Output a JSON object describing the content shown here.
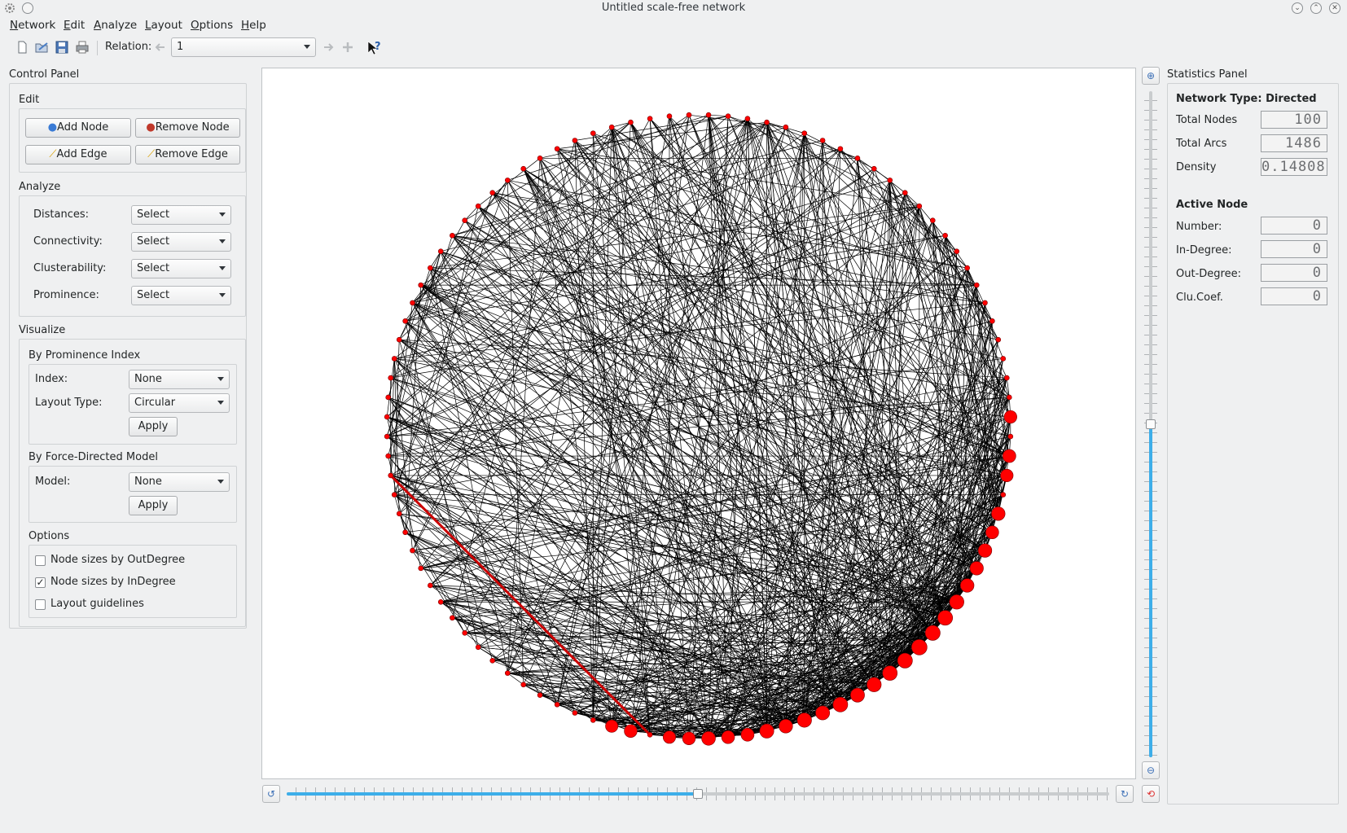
{
  "window": {
    "title": "Untitled scale-free network"
  },
  "menubar": {
    "items": [
      "Network",
      "Edit",
      "Analyze",
      "Layout",
      "Options",
      "Help"
    ],
    "mnemonics": [
      "N",
      "E",
      "A",
      "L",
      "O",
      "H"
    ]
  },
  "toolbar": {
    "relation_label": "Relation:",
    "relation_value": "1",
    "icons": [
      "new-file-icon",
      "open-file-icon",
      "save-icon",
      "print-icon",
      "previous-relation-icon",
      "next-relation-icon",
      "add-relation-icon",
      "whats-this-icon"
    ]
  },
  "control_panel": {
    "title": "Control Panel",
    "edit": {
      "title": "Edit",
      "add_node": "Add Node",
      "remove_node": "Remove Node",
      "add_edge": "Add Edge",
      "remove_edge": "Remove Edge"
    },
    "analyze": {
      "title": "Analyze",
      "rows": [
        {
          "label": "Distances:",
          "value": "Select"
        },
        {
          "label": "Connectivity:",
          "value": "Select"
        },
        {
          "label": "Clusterability:",
          "value": "Select"
        },
        {
          "label": "Prominence:",
          "value": "Select"
        }
      ]
    },
    "visualize": {
      "title": "Visualize",
      "prominence": {
        "title": "By Prominence Index",
        "index_label": "Index:",
        "index_value": "None",
        "layout_label": "Layout Type:",
        "layout_value": "Circular",
        "apply": "Apply"
      },
      "force": {
        "title": "By Force-Directed Model",
        "model_label": "Model:",
        "model_value": "None",
        "apply": "Apply"
      }
    },
    "options": {
      "title": "Options",
      "items": [
        {
          "label": "Node sizes by OutDegree",
          "checked": false
        },
        {
          "label": "Node sizes by InDegree",
          "checked": true
        },
        {
          "label": "Layout guidelines",
          "checked": false
        }
      ]
    }
  },
  "statistics_panel": {
    "title": "Statistics Panel",
    "network_type": "Network Type: Directed",
    "total_nodes_label": "Total Nodes",
    "total_nodes": "100",
    "total_arcs_label": "Total Arcs",
    "total_arcs": "1486",
    "density_label": "Density",
    "density": "0.14808",
    "active_node_title": "Active Node",
    "number_label": "Number:",
    "number": "0",
    "indegree_label": "In-Degree:",
    "indegree": "0",
    "outdegree_label": "Out-Degree:",
    "outdegree": "0",
    "clucoef_label": "Clu.Coef.",
    "clucoef": "0"
  },
  "graph": {
    "node_count": 100,
    "node_color": "#ff0000",
    "edge_color": "#000000",
    "highlight_edge_color": "#cc0000",
    "layout": "circular"
  },
  "view_controls": {
    "zoom_level": 0.5,
    "rotation_level": 0.5
  }
}
